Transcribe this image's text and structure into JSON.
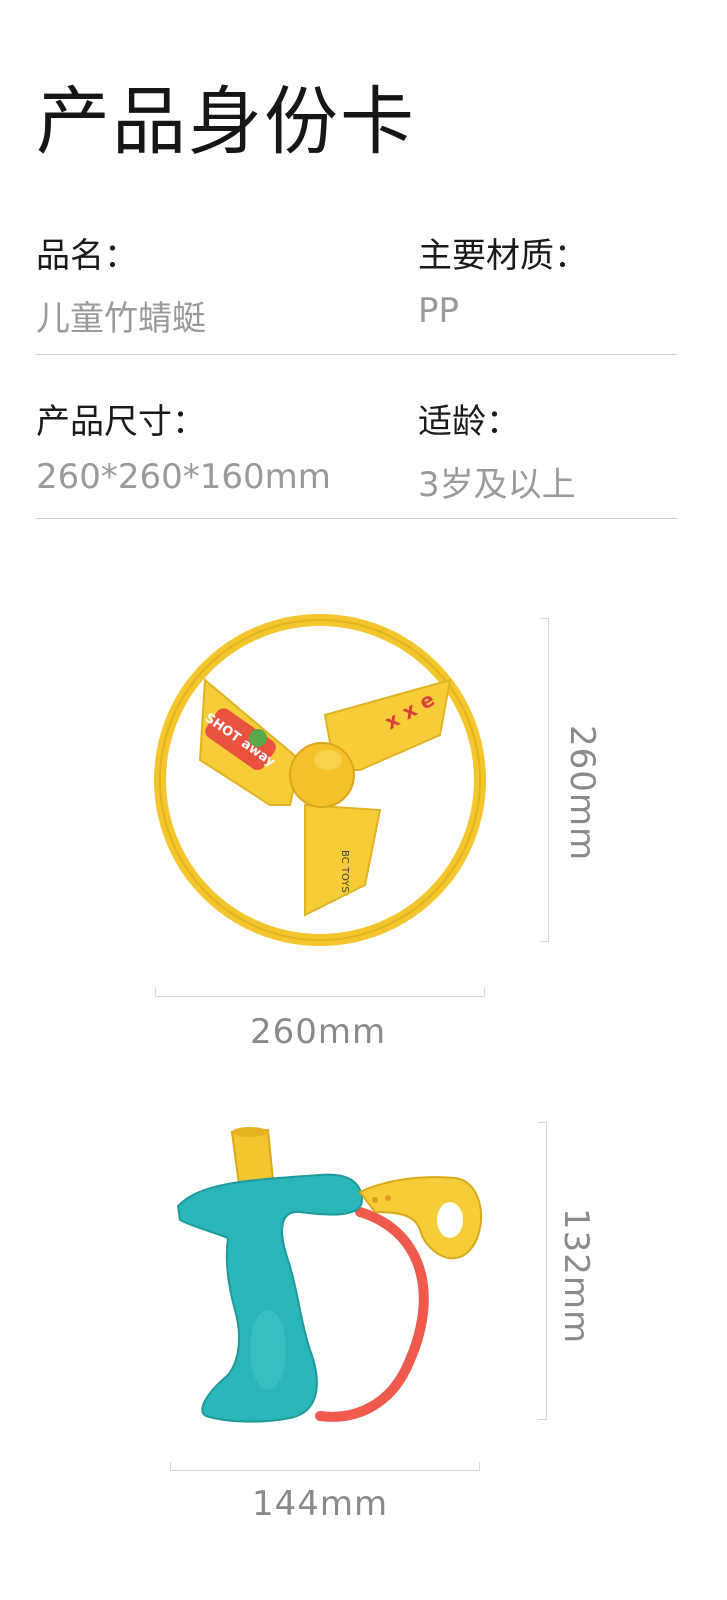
{
  "title": "产品身份卡",
  "specs": {
    "name_label": "品名：",
    "name_value": "儿童竹蜻蜓",
    "material_label": "主要材质：",
    "material_value": "PP",
    "size_label": "产品尺寸：",
    "size_value": "260*260*160mm",
    "age_label": "适龄：",
    "age_value": "3岁及以上"
  },
  "disc": {
    "width_label": "260mm",
    "height_label": "260mm",
    "sticker_left": "SHOT away",
    "sticker_right": "x x e",
    "brand": "BC TOYS"
  },
  "launcher": {
    "width_label": "144mm",
    "height_label": "132mm"
  },
  "colors": {
    "disc_yellow": "#f6cd38",
    "launcher_teal": "#2ab6b8",
    "cord_red": "#ef5a4c"
  }
}
